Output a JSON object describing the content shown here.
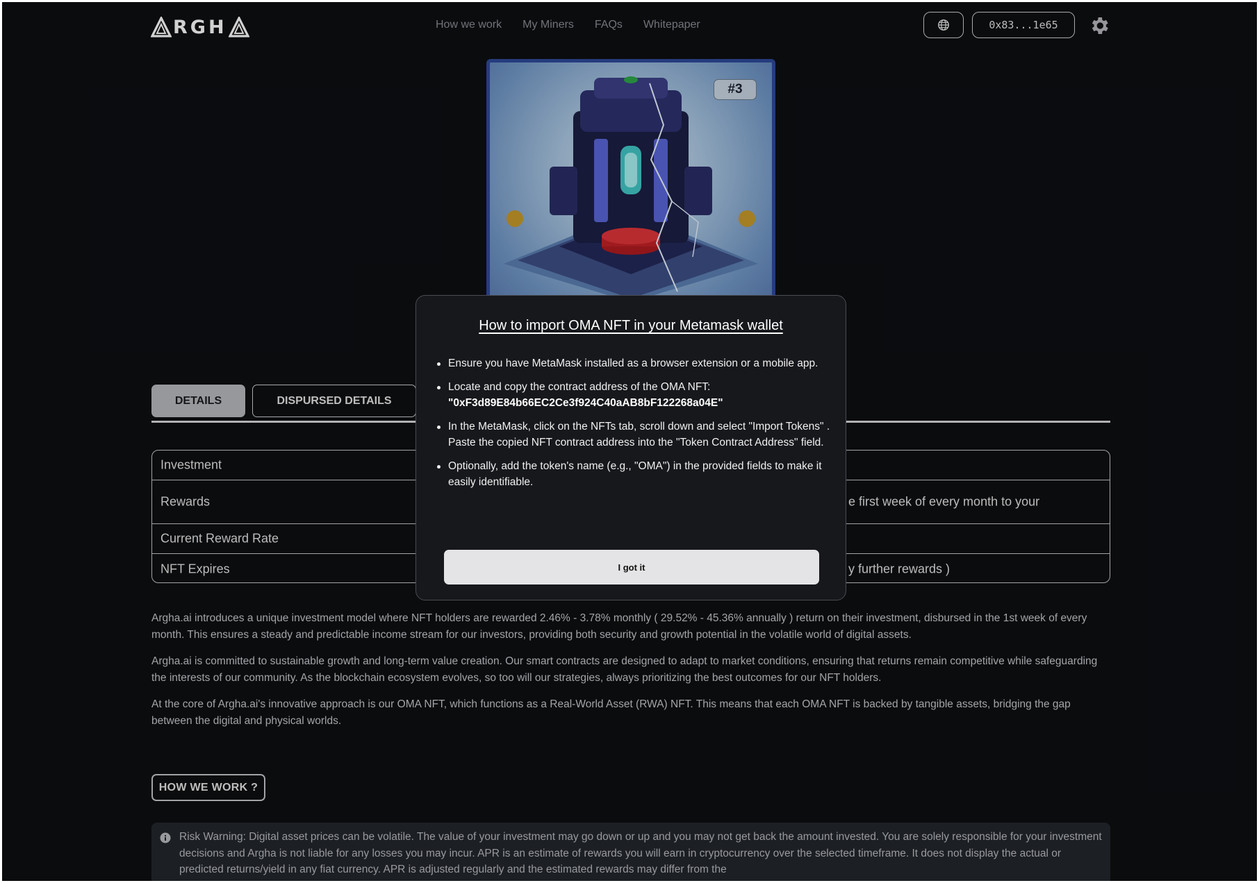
{
  "header": {
    "logo_text": "RGH",
    "nav": [
      "How we work",
      "My Miners",
      "FAQs",
      "Whitepaper"
    ],
    "wallet_address": "0x83...1e65",
    "icons": {
      "globe": "globe-icon",
      "settings": "gear-icon"
    }
  },
  "nft": {
    "badge": "#3"
  },
  "tabs": {
    "details": "DETAILS",
    "disbursed": "DISPURSED DETAILS"
  },
  "details": {
    "rows": [
      {
        "label": "Investment",
        "value": ""
      },
      {
        "label": "Rewards",
        "value": "e first week of every month to your"
      },
      {
        "label": "Current Reward Rate",
        "value": ""
      },
      {
        "label": "NFT Expires",
        "value": "y further rewards )"
      }
    ]
  },
  "paragraphs": [
    "Argha.ai introduces a unique investment model where NFT holders are rewarded 2.46% - 3.78% monthly ( 29.52% - 45.36% annually ) return on their investment, disbursed in the 1st week of every month. This ensures a steady and predictable income stream for our investors, providing both security and growth potential in the volatile world of digital assets.",
    "Argha.ai is committed to sustainable growth and long-term value creation. Our smart contracts are designed to adapt to market conditions, ensuring that returns remain competitive while safeguarding the interests of our community. As the blockchain ecosystem evolves, so too will our strategies, always prioritizing the best outcomes for our NFT holders.",
    "At the core of Argha.ai's innovative approach is our OMA NFT, which functions as a Real-World Asset (RWA) NFT. This means that each OMA NFT is backed by tangible assets, bridging the gap between the digital and physical worlds."
  ],
  "how_button": "HOW WE WORK ?",
  "risk_warning": "Risk Warning: Digital asset prices can be volatile. The value of your investment may go down or up and you may not get back the amount invested. You are solely responsible for your investment decisions and Argha is not liable for any losses you may incur. APR is an estimate of rewards you will earn in cryptocurrency over the selected timeframe. It does not display the actual or predicted returns/yield in any fiat currency. APR is adjusted regularly and the estimated rewards may differ from the",
  "modal": {
    "title": "How to import OMA NFT in your Metamask wallet",
    "step1": "Ensure you have MetaMask installed as a browser extension or a mobile app.",
    "step2": "Locate and copy the contract address of the OMA NFT:",
    "contract_address": "\"0xF3d89E84b66EC2Ce3f924C40aAB8bF122268a04E\"",
    "step3": "In the MetaMask, click on the NFTs tab, scroll down and select \"Import Tokens\" . Paste the copied NFT contract address into the \"Token Contract Address\" field.",
    "step4": "Optionally, add the token's name (e.g., \"OMA\") in the provided fields to make it easily identifiable.",
    "button": "I got it"
  },
  "colors": {
    "background": "#0e0f12",
    "nft_border": "#2e4a9a",
    "modal_bg": "#17181c"
  }
}
